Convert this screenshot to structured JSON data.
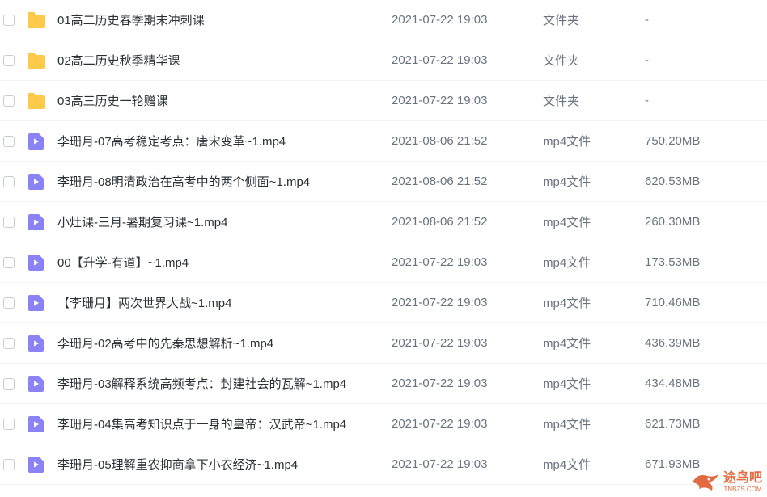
{
  "rows": [
    {
      "kind": "folder",
      "name": "01高二历史春季期末冲刺课",
      "date": "2021-07-22 19:03",
      "type": "文件夹",
      "size": "-"
    },
    {
      "kind": "folder",
      "name": "02高二历史秋季精华课",
      "date": "2021-07-22 19:03",
      "type": "文件夹",
      "size": "-"
    },
    {
      "kind": "folder",
      "name": "03高三历史一轮赠课",
      "date": "2021-07-22 19:03",
      "type": "文件夹",
      "size": "-"
    },
    {
      "kind": "video",
      "name": "李珊月-07高考稳定考点：唐宋变革~1.mp4",
      "date": "2021-08-06 21:52",
      "type": "mp4文件",
      "size": "750.20MB"
    },
    {
      "kind": "video",
      "name": "李珊月-08明清政治在高考中的两个侧面~1.mp4",
      "date": "2021-08-06 21:52",
      "type": "mp4文件",
      "size": "620.53MB"
    },
    {
      "kind": "video",
      "name": "小灶课-三月-暑期复习课~1.mp4",
      "date": "2021-08-06 21:52",
      "type": "mp4文件",
      "size": "260.30MB"
    },
    {
      "kind": "video",
      "name": "00【升学-有道】~1.mp4",
      "date": "2021-07-22 19:03",
      "type": "mp4文件",
      "size": "173.53MB"
    },
    {
      "kind": "video",
      "name": "【李珊月】两次世界大战~1.mp4",
      "date": "2021-07-22 19:03",
      "type": "mp4文件",
      "size": "710.46MB"
    },
    {
      "kind": "video",
      "name": "李珊月-02高考中的先秦思想解析~1.mp4",
      "date": "2021-07-22 19:03",
      "type": "mp4文件",
      "size": "436.39MB"
    },
    {
      "kind": "video",
      "name": "李珊月-03解释系统高频考点：封建社会的瓦解~1.mp4",
      "date": "2021-07-22 19:03",
      "type": "mp4文件",
      "size": "434.48MB"
    },
    {
      "kind": "video",
      "name": "李珊月-04集高考知识点于一身的皇帝：汉武帝~1.mp4",
      "date": "2021-07-22 19:03",
      "type": "mp4文件",
      "size": "621.73MB"
    },
    {
      "kind": "video",
      "name": "李珊月-05理解重农抑商拿下小农经济~1.mp4",
      "date": "2021-07-22 19:03",
      "type": "mp4文件",
      "size": "671.93MB"
    }
  ],
  "icons": {
    "folder": "folder-icon",
    "video": "video-file-icon"
  },
  "colors": {
    "folder": "#ffc94a",
    "video": "#8b83f5"
  },
  "watermark": {
    "cn": "途鸟吧",
    "en": "TNBZS.COM"
  }
}
